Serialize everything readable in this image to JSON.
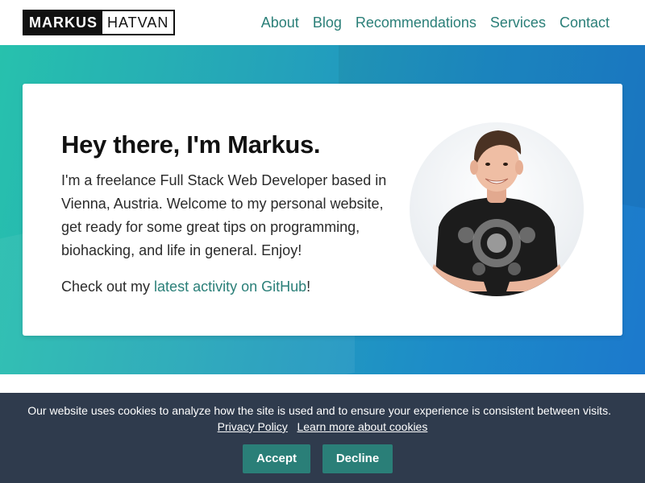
{
  "header": {
    "logo_first": "MARKUS",
    "logo_last": "HATVAN",
    "nav": [
      "About",
      "Blog",
      "Recommendations",
      "Services",
      "Contact"
    ]
  },
  "hero": {
    "title": "Hey there, I'm Markus.",
    "intro": "I'm a freelance Full Stack Web Developer based in Vienna, Austria. Welcome to my personal website, get ready for some great tips on programming, biohacking, and life in general. Enjoy!",
    "github_prefix": "Check out my ",
    "github_link": "latest activity on GitHub",
    "github_suffix": "!"
  },
  "cookie_banner": {
    "text": "Our website uses cookies to analyze how the site is used and to ensure your experience is consistent between visits.",
    "privacy_link": "Privacy Policy",
    "learn_more_link": "Learn more about cookies",
    "accept": "Accept",
    "decline": "Decline"
  },
  "colors": {
    "accent": "#2a7f78",
    "hero_gradient_start": "#27c1ad",
    "hero_gradient_end": "#1c79cc",
    "cookie_bg": "#2f3b4d"
  }
}
